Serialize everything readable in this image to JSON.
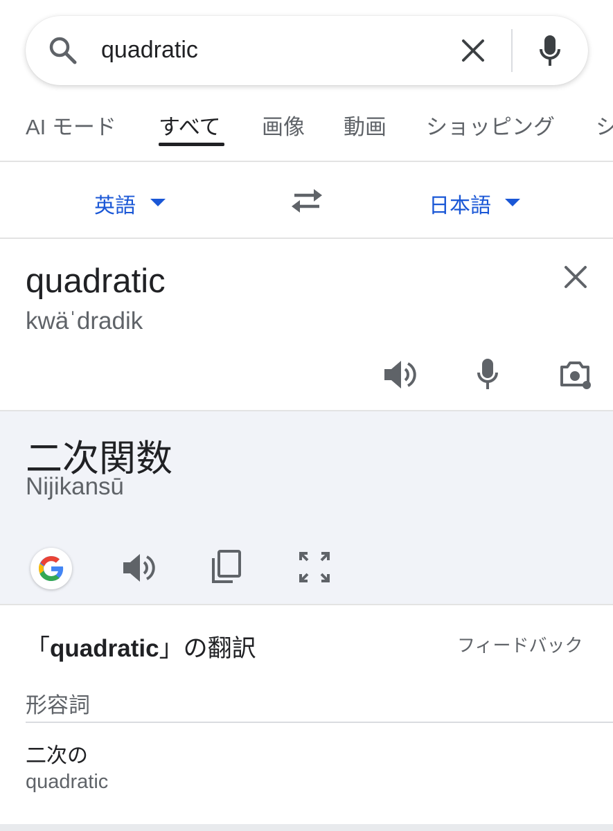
{
  "search": {
    "query": "quadratic"
  },
  "tabs": [
    {
      "label": "AI モード"
    },
    {
      "label": "すべて"
    },
    {
      "label": "画像"
    },
    {
      "label": "動画"
    },
    {
      "label": "ショッピング"
    },
    {
      "label": "シ"
    }
  ],
  "translator": {
    "source_lang": "英語",
    "target_lang": "日本語",
    "source": {
      "text": "quadratic",
      "pronunciation": "kwäˈdradik"
    },
    "target": {
      "text": "二次関数",
      "romanization": "Nijikansū"
    }
  },
  "translations": {
    "title_open": "「",
    "title_word": "quadratic",
    "title_close": "」の翻訳",
    "feedback": "フィードバック",
    "part_of_speech": "形容詞",
    "entries": [
      {
        "word": "二次の",
        "back": "quadratic"
      }
    ]
  },
  "colors": {
    "link_blue": "#1a57d6",
    "panel_bg": "#f1f3f8",
    "text": "#202124",
    "muted": "#5f6368"
  }
}
